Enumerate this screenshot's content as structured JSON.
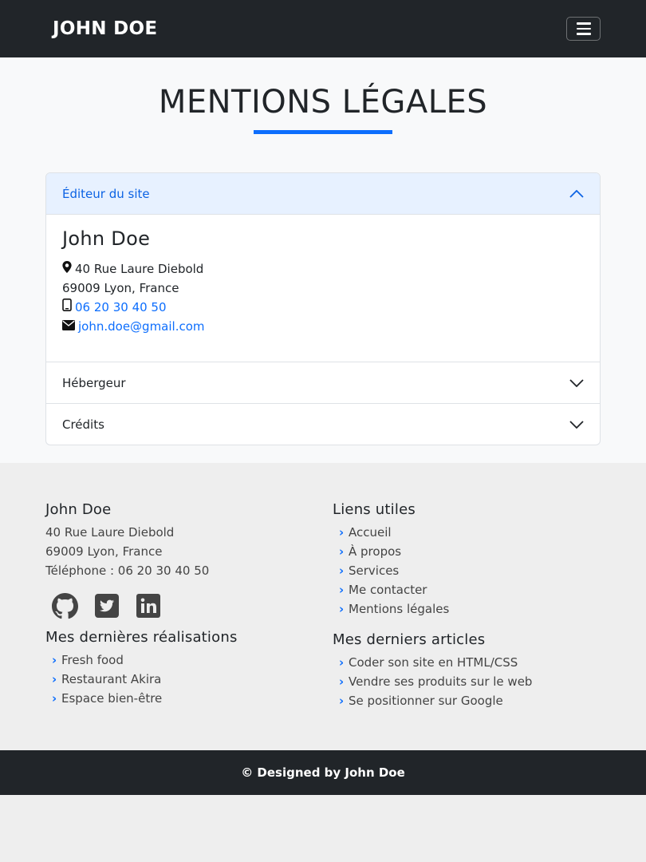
{
  "nav": {
    "brand": "JOHN DOE",
    "menu_icon": "hamburger-icon"
  },
  "page": {
    "title": "MENTIONS LÉGALES"
  },
  "accordion": {
    "items": [
      {
        "label": "Éditeur du site",
        "state": "open"
      },
      {
        "label": "Hébergeur",
        "state": "closed"
      },
      {
        "label": "Crédits",
        "state": "closed"
      }
    ],
    "editor": {
      "name": "John Doe",
      "address_line1": "40 Rue Laure Diebold",
      "address_line2": "69009 Lyon, France",
      "phone": "06 20 30 40 50",
      "email": "john.doe@gmail.com"
    }
  },
  "footer": {
    "contact": {
      "title": "John Doe",
      "address_line1": "40 Rue Laure Diebold",
      "address_line2": "69009 Lyon, France",
      "phone": "Téléphone : 06 20 30 40 50"
    },
    "social_icons": [
      "github-icon",
      "twitter-icon",
      "linkedin-icon"
    ],
    "links": {
      "title": "Liens utiles",
      "items": [
        "Accueil",
        "À propos",
        "Services",
        "Me contacter",
        "Mentions légales"
      ]
    },
    "works": {
      "title": "Mes dernières réalisations",
      "items": [
        "Fresh food",
        "Restaurant Akira",
        "Espace bien-être"
      ]
    },
    "articles": {
      "title": "Mes derniers articles",
      "items": [
        "Coder son site en HTML/CSS",
        "Vendre ses produits sur le web",
        "Se positionner sur Google"
      ]
    },
    "copyright": "© Designed by John Doe"
  },
  "colors": {
    "accent": "#0d6efd",
    "dark": "#212529",
    "light_bg": "#f8f9fa",
    "footer_bg": "#eeeeee"
  }
}
